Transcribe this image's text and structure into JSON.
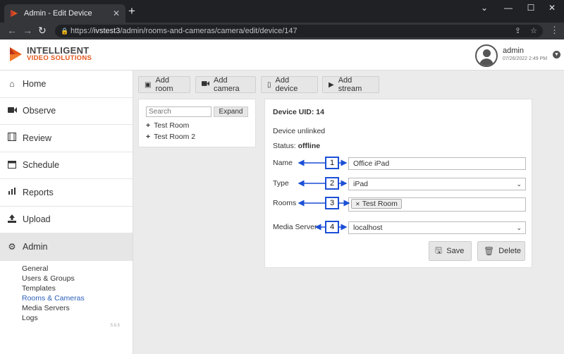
{
  "browser": {
    "tab_title": "Admin - Edit Device",
    "url_prefix": "https://",
    "url_host": "ivstest3",
    "url_path": "/admin/rooms-and-cameras/camera/edit/device/147"
  },
  "header": {
    "logo_line1": "INTELLIGENT",
    "logo_line2": "VIDEO SOLUTIONS",
    "user_name": "admin",
    "user_time": "07/26/2022 2:49 PM"
  },
  "sidebar": {
    "items": [
      {
        "label": "Home",
        "icon": "home-icon"
      },
      {
        "label": "Observe",
        "icon": "video-camera-icon"
      },
      {
        "label": "Review",
        "icon": "film-icon"
      },
      {
        "label": "Schedule",
        "icon": "calendar-icon"
      },
      {
        "label": "Reports",
        "icon": "bar-chart-icon"
      },
      {
        "label": "Upload",
        "icon": "upload-icon"
      },
      {
        "label": "Admin",
        "icon": "gear-icon"
      }
    ],
    "subitems": [
      "General",
      "Users & Groups",
      "Templates",
      "Rooms & Cameras",
      "Media Servers",
      "Logs"
    ],
    "version": "5.6.5"
  },
  "actions": {
    "add_room": "Add room",
    "add_camera": "Add camera",
    "add_device": "Add device",
    "add_stream": "Add stream"
  },
  "tree": {
    "search_placeholder": "Search",
    "expand_label": "Expand",
    "rooms": [
      "Test Room",
      "Test Room 2"
    ]
  },
  "form": {
    "uid_label": "Device UID: 14",
    "link_status": "Device unlinked",
    "status_label": "Status:",
    "status_value": "offline",
    "name_label": "Name",
    "name_value": "Office iPad",
    "type_label": "Type",
    "type_value": "iPad",
    "rooms_label": "Rooms",
    "rooms_tag": "Test Room",
    "media_label": "Media Server",
    "media_value": "localhost",
    "save_label": "Save",
    "delete_label": "Delete"
  },
  "callouts": [
    "1",
    "2",
    "3",
    "4"
  ],
  "colors": {
    "accent_orange": "#e5571b",
    "callout_blue": "#1b4fd6",
    "link_blue": "#2b5fb8"
  }
}
